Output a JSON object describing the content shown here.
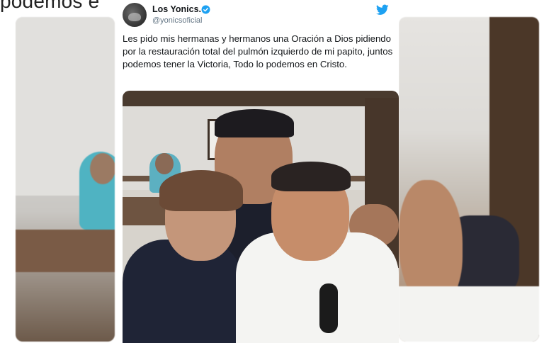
{
  "top_text": "podemos e",
  "tweet": {
    "author_name": "Los Yonics.",
    "handle": "@yonicsoficial",
    "body": "Les pido mis hermanas y hermanos una Oración a Dios pidiendo por la restauración total del pulmón izquierdo de mi papito, juntos podemos tener la Victoria, Todo lo podemos en Cristo.",
    "icons": {
      "avatar": "avatar-image",
      "verified": "verified-badge-icon",
      "brand": "twitter-bird-icon"
    },
    "colors": {
      "brand": "#1da1f2",
      "name": "#14171a",
      "handle": "#657786"
    }
  }
}
